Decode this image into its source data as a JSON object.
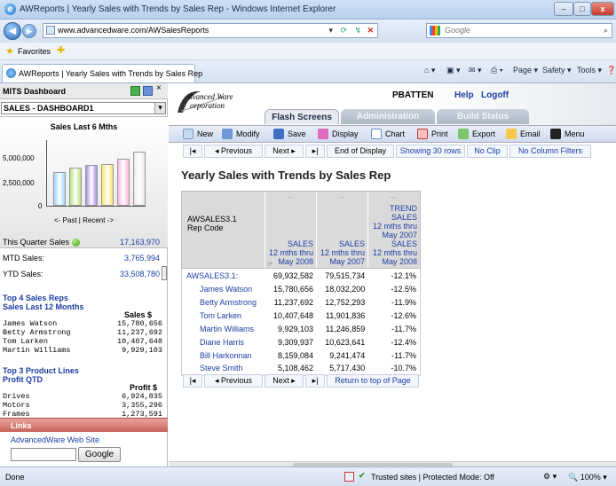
{
  "window": {
    "title": "AWReports | Yearly Sales with Trends by Sales Rep - Windows Internet Explorer"
  },
  "browser": {
    "address": "www.advancedware.com/AWSalesReports",
    "search_placeholder": "Google",
    "favorites_label": "Favorites",
    "tab_title": "AWReports | Yearly Sales with Trends by Sales Rep",
    "cmd_page": "Page",
    "cmd_safety": "Safety",
    "cmd_tools": "Tools"
  },
  "sidebar": {
    "title": "MITS Dashboard",
    "dropdown_value": "SALES - DASHBOARD1",
    "chart_title": "Sales Last 6 Mths",
    "chart_ylabels": [
      "5,000,000",
      "2,500,000",
      "0"
    ],
    "chart_bars": [
      0.52,
      0.58,
      0.62,
      0.64,
      0.71,
      0.82
    ],
    "chart_colors": [
      "#9fd6ff",
      "#b7e27a",
      "#a58fe0",
      "#ffe36a",
      "#ffb6d9",
      "#e8e8e8"
    ],
    "chart_nav": "<- Past | Recent ->",
    "this_quarter_label": "This Quarter Sales",
    "this_quarter_value": "17,163,970",
    "mtd_label": "MTD Sales:",
    "mtd_value": "3,765,994",
    "ytd_label": "YTD Sales:",
    "ytd_value": "33,508,780",
    "top_reps_title": "Top 4 Sales Reps\nSales Last 12 Months",
    "top_reps_header": "Sales $",
    "top_reps": [
      {
        "name": "James Watson",
        "value": "15,780,656"
      },
      {
        "name": "Betty Armstrong",
        "value": "11,237,692"
      },
      {
        "name": "Tom Larken",
        "value": "10,407,648"
      },
      {
        "name": "Martin Williams",
        "value": "9,929,103"
      }
    ],
    "top_products_title": "Top 3 Product Lines\nProfit QTD",
    "top_products_header": "Profit $",
    "top_products": [
      {
        "name": "Drives",
        "value": "6,924,835"
      },
      {
        "name": "Motors",
        "value": "3,355,296"
      },
      {
        "name": "Frames",
        "value": "1,273,591"
      }
    ],
    "links_title": "Links",
    "link1": "AdvancedWare Web Site",
    "google_button": "Google"
  },
  "header": {
    "logo_line1": "dvanced Ware",
    "logo_line2": "orporation",
    "user": "PBATTEN",
    "help": "Help",
    "logoff": "Logoff",
    "tabs": [
      "Flash Screens",
      "Administration",
      "Build Status"
    ]
  },
  "toolbar": [
    "New",
    "Modify",
    "Save",
    "Display",
    "Chart",
    "Print",
    "Export",
    "Email",
    "Menu"
  ],
  "pager": {
    "first": "|◂",
    "prev": "◂ Previous",
    "next": "Next ▸",
    "last": "▸|",
    "end": "End of Display",
    "showing": "Showing 30 rows",
    "noclip": "No Clip",
    "nofilters": "No Column Filters",
    "return": "Return to top of Page"
  },
  "report": {
    "title": "Yearly Sales with Trends by Sales Rep",
    "col0": "AWSALES3.1\nRep Code",
    "col1": "SALES\n12 mths thru\nMay 2008",
    "col2": "SALES\n12 mths thru\nMay 2007",
    "col3": "TREND\nSALES\n12 mths thru\nMay 2007\nSALES\n12 mths thru\nMay 2008",
    "dots": "....",
    "total": {
      "name": "AWSALES3.1:",
      "s1": "69,932,582",
      "s2": "79,515,734",
      "trend": "-12.1%"
    },
    "rows": [
      {
        "name": "James Watson",
        "s1": "15,780,656",
        "s2": "18,032,200",
        "trend": "-12.5%"
      },
      {
        "name": "Betty Armstrong",
        "s1": "11,237,692",
        "s2": "12,752,293",
        "trend": "-11.9%"
      },
      {
        "name": "Tom Larken",
        "s1": "10,407,648",
        "s2": "11,901,836",
        "trend": "-12.6%"
      },
      {
        "name": "Martin Williams",
        "s1": "9,929,103",
        "s2": "11,246,859",
        "trend": "-11.7%"
      },
      {
        "name": "Diane Harris",
        "s1": "9,309,937",
        "s2": "10,623,641",
        "trend": "-12.4%"
      },
      {
        "name": "Bill Harkonnan",
        "s1": "8,159,084",
        "s2": "9,241,474",
        "trend": "-11.7%"
      },
      {
        "name": "Steve Smith",
        "s1": "5,108,462",
        "s2": "5,717,430",
        "trend": "-10.7%"
      }
    ]
  },
  "status": {
    "left": "Done",
    "zone": "Trusted sites | Protected Mode: Off",
    "zoom": "100%"
  }
}
